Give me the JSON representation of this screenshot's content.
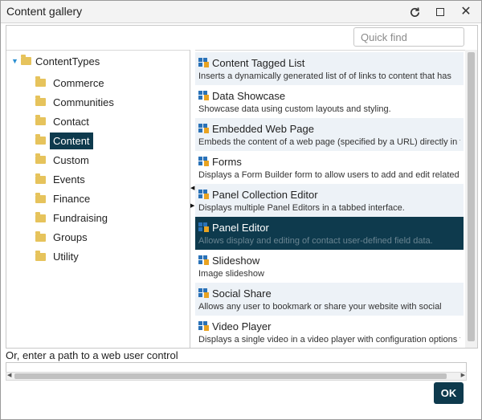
{
  "window": {
    "title": "Content gallery",
    "controls": {
      "refresh": "↻",
      "maximize": "",
      "close": "✕"
    }
  },
  "search": {
    "placeholder": "Quick find",
    "value": ""
  },
  "tree": {
    "root": {
      "label": "ContentTypes",
      "expanded": true
    },
    "items": [
      {
        "label": "Commerce"
      },
      {
        "label": "Communities"
      },
      {
        "label": "Contact"
      },
      {
        "label": "Content",
        "selected": true
      },
      {
        "label": "Custom"
      },
      {
        "label": "Events"
      },
      {
        "label": "Finance"
      },
      {
        "label": "Fundraising"
      },
      {
        "label": "Groups"
      },
      {
        "label": "Utility"
      }
    ]
  },
  "items": [
    {
      "title": "Content Tagged List",
      "desc": "Inserts a dynamically generated list of of links to content that has"
    },
    {
      "title": "Data Showcase",
      "desc": "Showcase data using custom layouts and styling."
    },
    {
      "title": "Embedded Web Page",
      "desc": "Embeds the content of a web page (specified by a URL) directly in the"
    },
    {
      "title": "Forms",
      "desc": "Displays a Form Builder form to allow users to add and edit related"
    },
    {
      "title": "Panel Collection Editor",
      "desc": "Displays multiple Panel Editors in a tabbed interface."
    },
    {
      "title": "Panel Editor",
      "desc": "Allows display and editing of contact user-defined field data.",
      "selected": true
    },
    {
      "title": "Slideshow",
      "desc": "Image slideshow"
    },
    {
      "title": "Social Share",
      "desc": "Allows any user to bookmark or share your website with social"
    },
    {
      "title": "Video Player",
      "desc": "Displays a single video in a video player with configuration options to"
    }
  ],
  "path": {
    "label": "Or, enter a path to a web user control",
    "value": ""
  },
  "buttons": {
    "ok": "OK"
  },
  "colors": {
    "accent": "#0e3a4d",
    "row_alt": "#edf2f7",
    "folder": "#e6c35c",
    "toggle": "#2b8fd1"
  }
}
